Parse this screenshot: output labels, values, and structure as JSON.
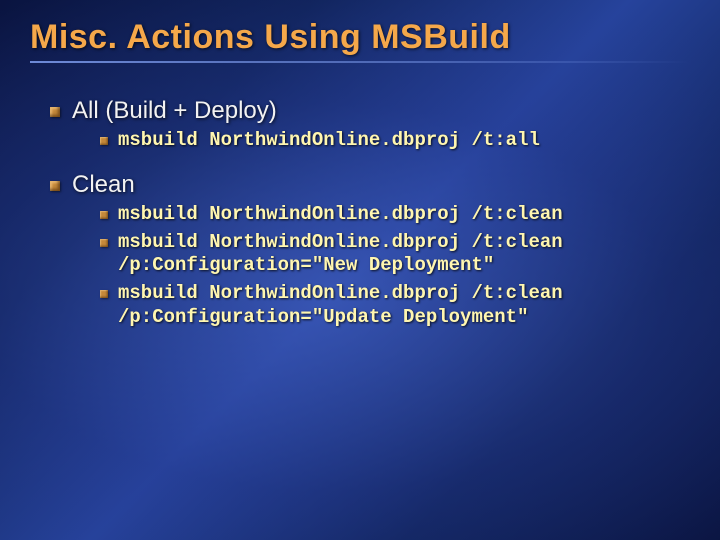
{
  "title": "Misc. Actions Using MSBuild",
  "sections": [
    {
      "label": "All (Build + Deploy)",
      "items": [
        "msbuild NorthwindOnline.dbproj /t:all"
      ]
    },
    {
      "label": "Clean",
      "items": [
        "msbuild NorthwindOnline.dbproj /t:clean",
        "msbuild NorthwindOnline.dbproj /t:clean /p:Configuration=\"New Deployment\"",
        "msbuild NorthwindOnline.dbproj /t:clean /p:Configuration=\"Update Deployment\""
      ]
    }
  ]
}
